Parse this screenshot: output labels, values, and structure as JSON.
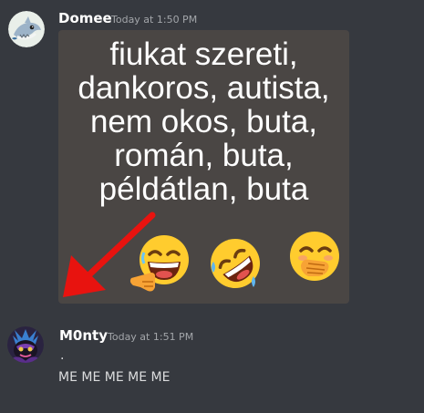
{
  "messages": [
    {
      "author": "Domee",
      "timestamp": "Today at 1:50 PM",
      "avatar_icon": "shark-avatar-icon",
      "image": {
        "lines": [
          "fiukat szereti,",
          "dankoros, autista,",
          "nem okos, buta,",
          "román, buta,",
          "példátlan, buta"
        ],
        "emojis": [
          "laughing-pointing-emoji",
          "rolling-on-floor-laughing-emoji",
          "hand-over-mouth-emoji"
        ],
        "arrow_color": "#e8130f"
      }
    },
    {
      "author": "M0nty",
      "timestamp": "Today at 1:51 PM",
      "avatar_icon": "dark-character-avatar-icon",
      "lines": [
        ".",
        "ME ME ME ME ME"
      ]
    }
  ],
  "theme": {
    "background": "#36393f",
    "username_color": "#ffffff",
    "timestamp_color": "#a3a6aa",
    "text_color": "#dcddde"
  }
}
